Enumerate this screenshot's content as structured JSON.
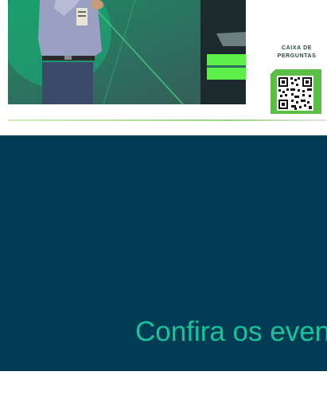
{
  "qr_panel": {
    "title": "CAIXA DE\nPERGUNTAS",
    "icon": "qr-code-icon"
  },
  "banner": {
    "text": "Confira os even"
  },
  "colors": {
    "banner_bg": "#003c53",
    "banner_text": "#19c39a",
    "accent_green": "#5bbf45",
    "stage_screen": "#5ef04a"
  }
}
